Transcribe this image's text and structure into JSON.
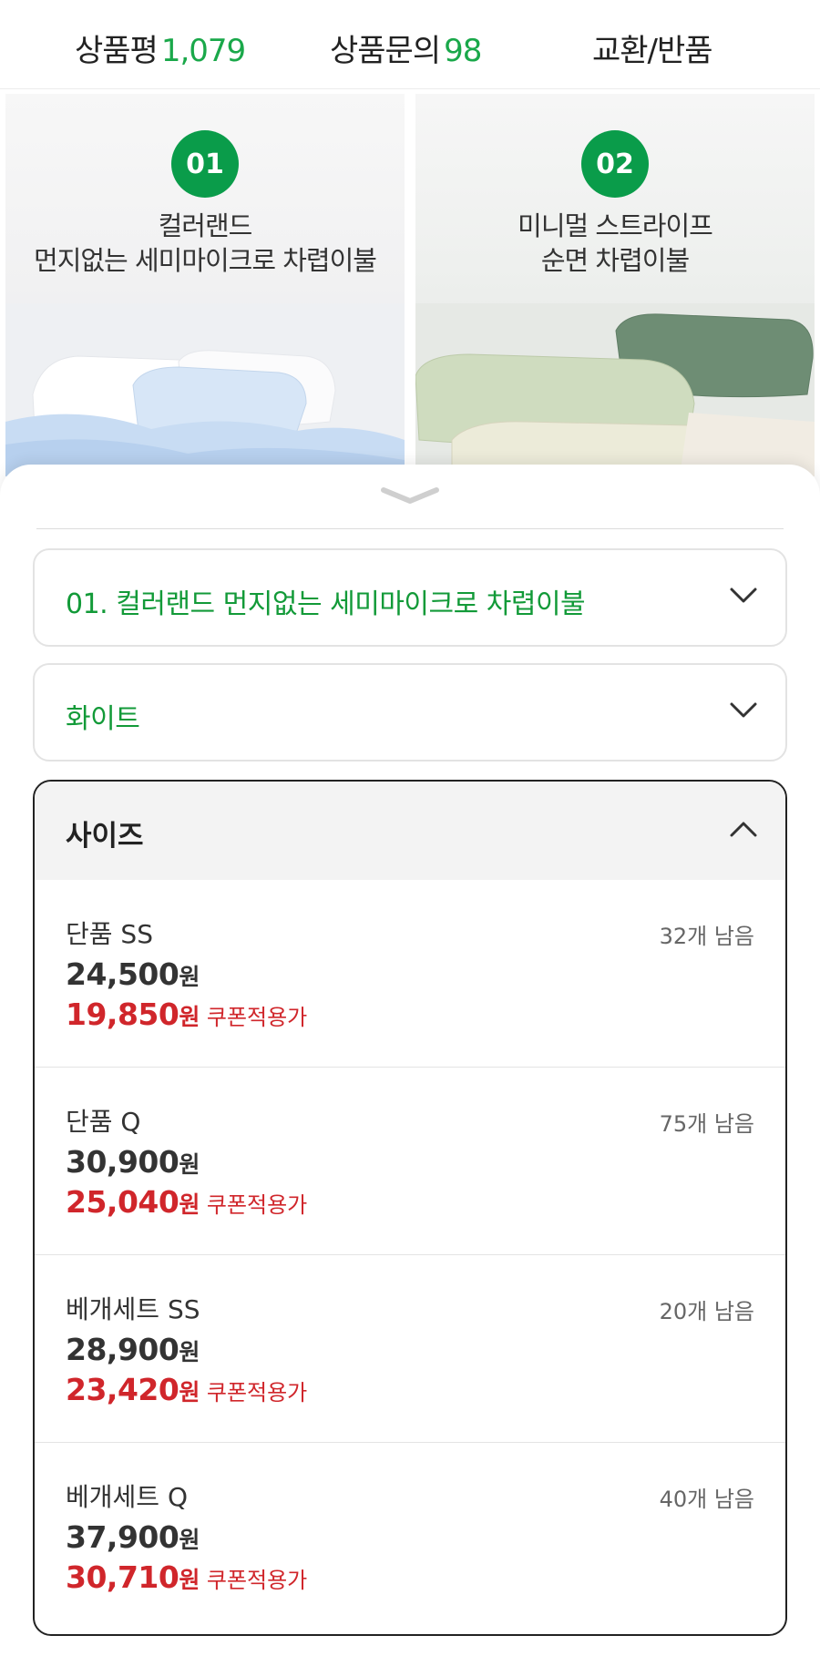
{
  "tabs": [
    {
      "label": "상품평",
      "count": "1,079"
    },
    {
      "label": "상품문의",
      "count": "98"
    },
    {
      "label": "교환/반품",
      "count": ""
    }
  ],
  "cards": [
    {
      "number": "01",
      "title_line1": "컬러랜드",
      "title_line2": "먼지없는 세미마이크로 차렵이불"
    },
    {
      "number": "02",
      "title_line1": "미니멀 스트라이프",
      "title_line2": "순면 차렵이불"
    }
  ],
  "sheet": {
    "product_select": {
      "value": "01. 컬러랜드 먼지없는 세미마이크로 차렵이불"
    },
    "color_select": {
      "value": "화이트"
    },
    "size_panel": {
      "label": "사이즈",
      "items": [
        {
          "name": "단품 SS",
          "stock": "32개 남음",
          "price": "24,500",
          "sale_price": "19,850",
          "won": "원",
          "coupon": "쿠폰적용가"
        },
        {
          "name": "단품 Q",
          "stock": "75개 남음",
          "price": "30,900",
          "sale_price": "25,040",
          "won": "원",
          "coupon": "쿠폰적용가"
        },
        {
          "name": "베개세트 SS",
          "stock": "20개 남음",
          "price": "28,900",
          "sale_price": "23,420",
          "won": "원",
          "coupon": "쿠폰적용가"
        },
        {
          "name": "베개세트 Q",
          "stock": "40개 남음",
          "price": "37,900",
          "sale_price": "30,710",
          "won": "원",
          "coupon": "쿠폰적용가"
        }
      ]
    }
  },
  "colors": {
    "accent_green": "#1aa84a",
    "badge_green": "#0a9c4a",
    "sale_red": "#d0262b"
  }
}
